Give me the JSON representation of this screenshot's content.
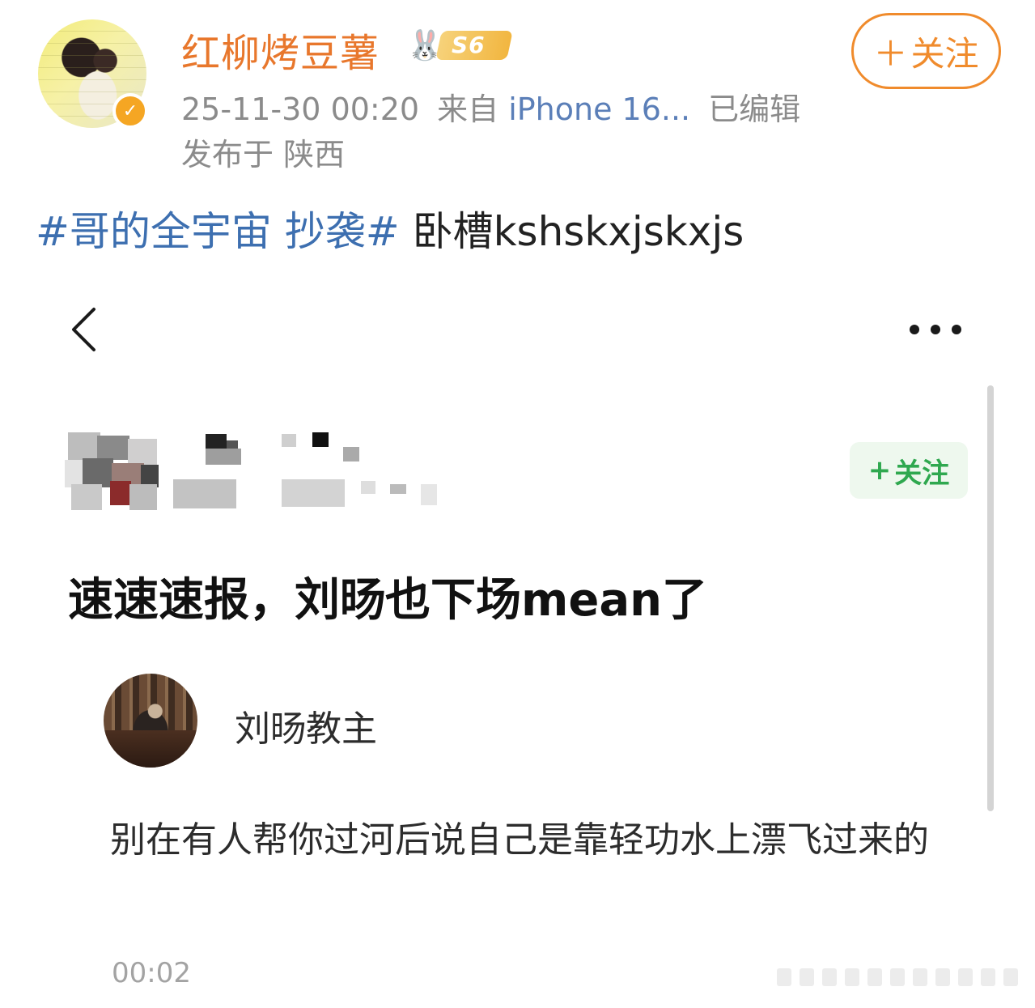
{
  "post": {
    "username": "红柳烤豆薯",
    "level": "S6",
    "follow_label": "关注",
    "timestamp": "25-11-30 00:20",
    "source_prefix": "来自",
    "device": "iPhone 16...",
    "edited": "已编辑",
    "location": "发布于 陕西",
    "topic": "#哥的全宇宙 抄袭#",
    "text": " 卧槽kshskxjskxjs"
  },
  "embedded": {
    "follow_label": "关注",
    "headline": "速速速报，刘旸也下场mean了",
    "quoted": {
      "name": "刘旸教主",
      "body": "别在有人帮你过河后说自己是靠轻功水上漂飞过来的",
      "time": "00:02"
    }
  },
  "colors": {
    "username": "#e8772c",
    "topic": "#3d6fb0",
    "follow_outer": "#f08b2c",
    "follow_inner": "#2fa84f"
  }
}
